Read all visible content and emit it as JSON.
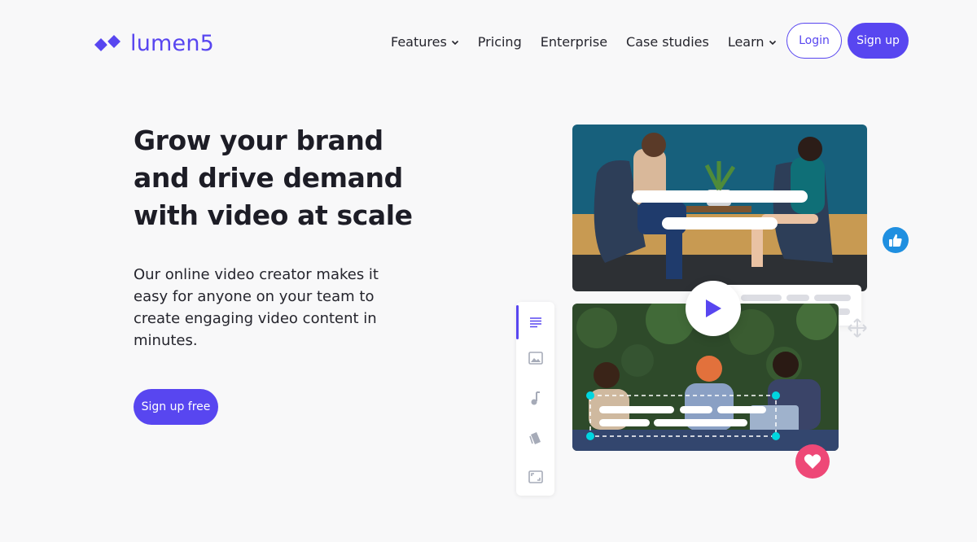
{
  "brand": {
    "name": "lumen5",
    "color": "#5846f0"
  },
  "nav": {
    "items": [
      {
        "label": "Features",
        "has_dropdown": true
      },
      {
        "label": "Pricing",
        "has_dropdown": false
      },
      {
        "label": "Enterprise",
        "has_dropdown": false
      },
      {
        "label": "Case studies",
        "has_dropdown": false
      },
      {
        "label": "Learn",
        "has_dropdown": true
      }
    ],
    "login_label": "Login",
    "signup_label": "Sign up"
  },
  "hero": {
    "title": "Grow your brand and drive demand with video at scale",
    "subtitle": "Our online video creator makes it easy for anyone on your team to create engaging video content in minutes.",
    "cta_label": "Sign up free"
  },
  "editor": {
    "tools": [
      "text-icon",
      "image-icon",
      "music-icon",
      "style-icon",
      "resize-icon"
    ],
    "active_tool": "text-icon",
    "badges": [
      "thumbs-up-icon",
      "heart-icon"
    ],
    "colors": {
      "accent": "#5846f0",
      "thumb": "#1f8fe0",
      "heart": "#ee4877",
      "handle": "#00d6e0"
    }
  }
}
